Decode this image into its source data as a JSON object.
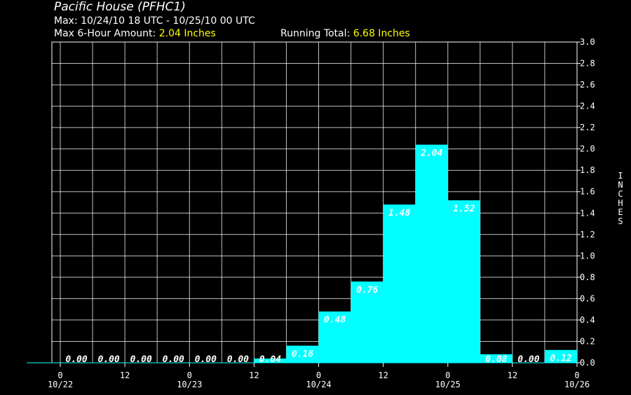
{
  "header": {
    "title": "Pacific House (PFHC1)",
    "max_label": "Max:",
    "max_period": "10/24/10 18 UTC - 10/25/10 00 UTC",
    "max6_label": "Max 6-Hour Amount:",
    "max6_value": "2.04 Inches",
    "running_label": "Running Total:",
    "running_value": "6.68 Inches"
  },
  "chart_data": {
    "type": "bar",
    "ylabel": "INCHES",
    "ylim": [
      0,
      3.0
    ],
    "yticks": [
      "0.0",
      "0.2",
      "0.4",
      "0.6",
      "0.8",
      "1.0",
      "1.2",
      "1.4",
      "1.6",
      "1.8",
      "2.0",
      "2.2",
      "2.4",
      "2.6",
      "2.8",
      "3.0"
    ],
    "xticks": [
      {
        "hour": "0",
        "date": "10/22"
      },
      {
        "hour": "12",
        "date": ""
      },
      {
        "hour": "0",
        "date": "10/23"
      },
      {
        "hour": "12",
        "date": ""
      },
      {
        "hour": "0",
        "date": "10/24"
      },
      {
        "hour": "12",
        "date": ""
      },
      {
        "hour": "0",
        "date": "10/25"
      },
      {
        "hour": "12",
        "date": ""
      },
      {
        "hour": "0",
        "date": "10/26"
      }
    ],
    "values": [
      0.0,
      0.0,
      0.0,
      0.0,
      0.0,
      0.0,
      0.04,
      0.16,
      0.48,
      0.76,
      1.48,
      2.04,
      1.52,
      0.08,
      0.0,
      0.12
    ],
    "labels": [
      "0.00",
      "0.00",
      "0.00",
      "0.00",
      "0.00",
      "0.00",
      "0.04",
      "0.16",
      "0.48",
      "0.76",
      "1.48",
      "2.04",
      "1.52",
      "0.08",
      "0.00",
      "0.12"
    ],
    "grid": true,
    "colors": {
      "bar": "#00ffff",
      "grid": "#ffffff",
      "background": "#000000",
      "highlight": "#ffff00"
    }
  }
}
